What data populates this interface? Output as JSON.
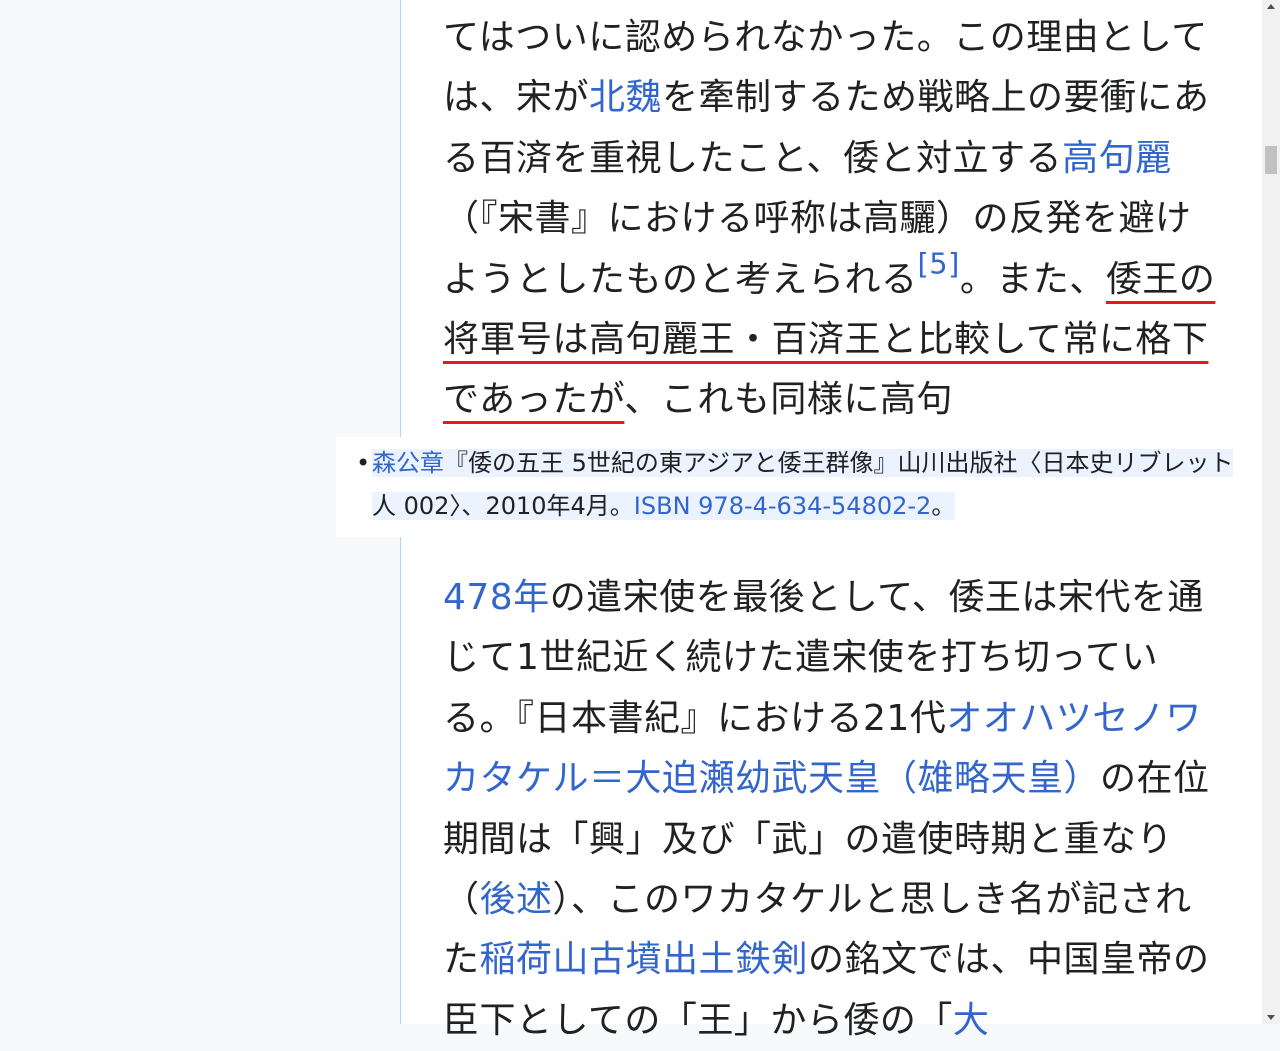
{
  "para1": {
    "t1": "てはついに認められなかった。この理由としては、宋が",
    "link_hokugi": "北魏",
    "t2": "を牽制するため戦略上の要衝にある百済を重視したこと、倭と対立する",
    "link_koguryo": "高句麗",
    "t3": "（『宋書』における呼称は高驪）の反発を避けようとしたものと考えられる",
    "ref5": "[5]",
    "t4": "。また、",
    "underlined": "倭王の将軍号は高句麗王・百済王と比較して常に格下であったが",
    "t5": "、これも同様に高句"
  },
  "popup": {
    "author": "森公章",
    "text": "『倭の五王 5世紀の東アジアと倭王群像』山川出版社〈日本史リブレット 人 002〉、2010年4月。",
    "isbn": "ISBN 978-4-634-54802-2",
    "end": "。"
  },
  "para2": {
    "link_478": "478年",
    "t1": "の遣宋使を最後として、倭王は宋代を通じて1世紀近く続けた遣宋使を打ち切っている。『日本書紀』における21代",
    "link_emperor": "オオハツセノワカタケル＝大迫瀬幼武天皇（雄略天皇）",
    "t2": "の在位期間は「興」及び「武」の遣使時期と重なり（",
    "link_later": "後述",
    "t3": "）、このワカタケルと思しき名が記された",
    "link_sword": "稲荷山古墳出土鉄剣",
    "t4": "の銘文では、中国皇帝の臣下としての「王」から倭の「",
    "link_end": "大"
  }
}
